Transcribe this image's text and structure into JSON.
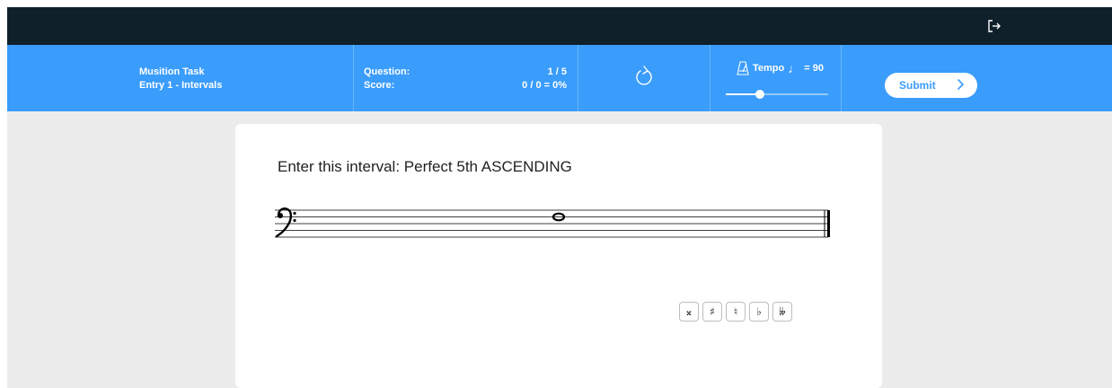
{
  "header": {
    "task_title": "Musition Task",
    "task_subtitle": "Entry 1 - Intervals",
    "question_label": "Question:",
    "question_value": "1 / 5",
    "score_label": "Score:",
    "score_value": "0 / 0 = 0%",
    "tempo_label": "Tempo",
    "tempo_equals": "= 90",
    "tempo_note_glyph": "♩",
    "tempo_value": 90,
    "tempo_slider_fraction": 0.33,
    "submit_label": "Submit"
  },
  "question": {
    "prompt": "Enter this interval: Perfect 5th ASCENDING",
    "clef": "bass",
    "note": "whole note on middle staff line"
  },
  "accidentals": [
    {
      "name": "double-sharp",
      "glyph": "𝄪"
    },
    {
      "name": "sharp",
      "glyph": "♯"
    },
    {
      "name": "natural",
      "glyph": "♮"
    },
    {
      "name": "flat",
      "glyph": "♭"
    },
    {
      "name": "double-flat",
      "glyph": "𝄫"
    }
  ],
  "colors": {
    "topbar": "#0f202a",
    "header_blue": "#3a9cfb",
    "background": "#ececec",
    "card": "#ffffff"
  },
  "icons": {
    "logout": "logout-icon",
    "restart": "restart-icon",
    "metronome": "metronome-icon",
    "submit": "chevron-right-icon"
  }
}
